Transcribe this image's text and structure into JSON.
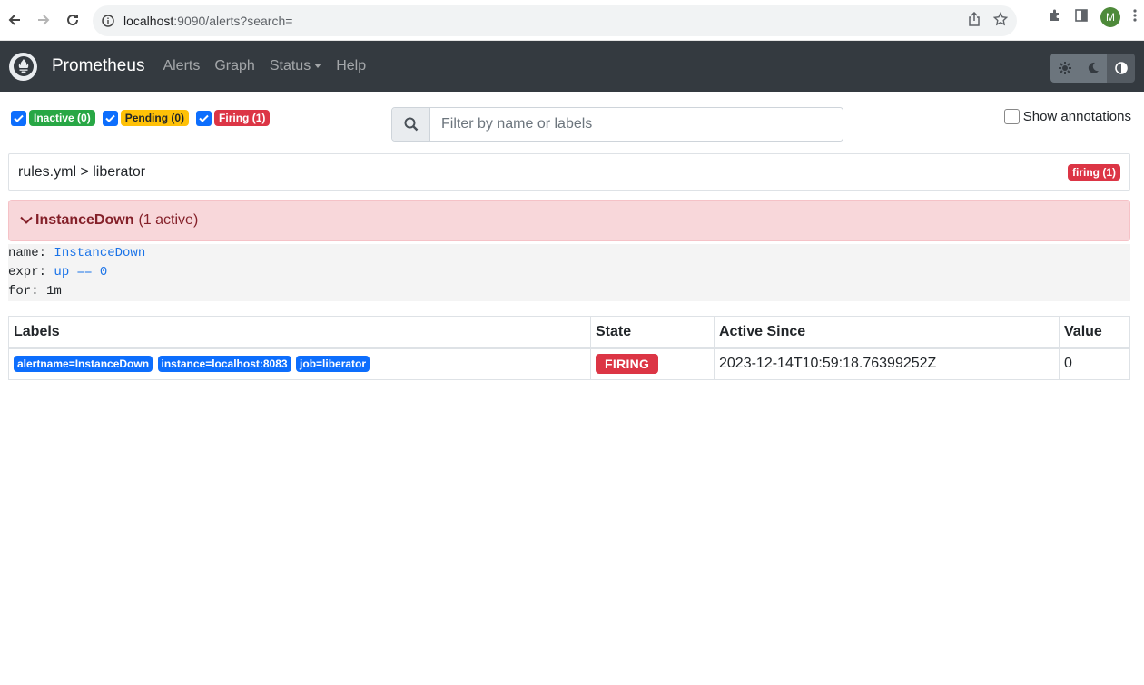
{
  "browser": {
    "url_host": "localhost",
    "url_rest": ":9090/alerts?search=",
    "avatar_letter": "M"
  },
  "navbar": {
    "brand": "Prometheus",
    "links": [
      "Alerts",
      "Graph",
      "Status",
      "Help"
    ]
  },
  "filters": {
    "inactive": "Inactive (0)",
    "pending": "Pending (0)",
    "firing": "Firing (1)"
  },
  "search": {
    "placeholder": "Filter by name or labels"
  },
  "annotations_label": "Show annotations",
  "group": {
    "title": "rules.yml > liberator",
    "badge": "firing (1)"
  },
  "rule": {
    "name": "InstanceDown",
    "active_text": "(1 active)",
    "def": {
      "name_key": "name:",
      "name_val": "InstanceDown",
      "expr_key": "expr:",
      "expr_val": "up == 0",
      "for_key": "for:",
      "for_val": "1m"
    }
  },
  "table": {
    "headers": [
      "Labels",
      "State",
      "Active Since",
      "Value"
    ],
    "rows": [
      {
        "labels": [
          "alertname=InstanceDown",
          "instance=localhost:8083",
          "job=liberator"
        ],
        "state": "FIRING",
        "active_since": "2023-12-14T10:59:18.76399252Z",
        "value": "0"
      }
    ]
  },
  "colors": {
    "navbar": "#343a40",
    "firing": "#dc3545",
    "inactive": "#28a745",
    "pending": "#ffc107",
    "label": "#0d6efd",
    "alert_bg": "#f8d7da"
  }
}
